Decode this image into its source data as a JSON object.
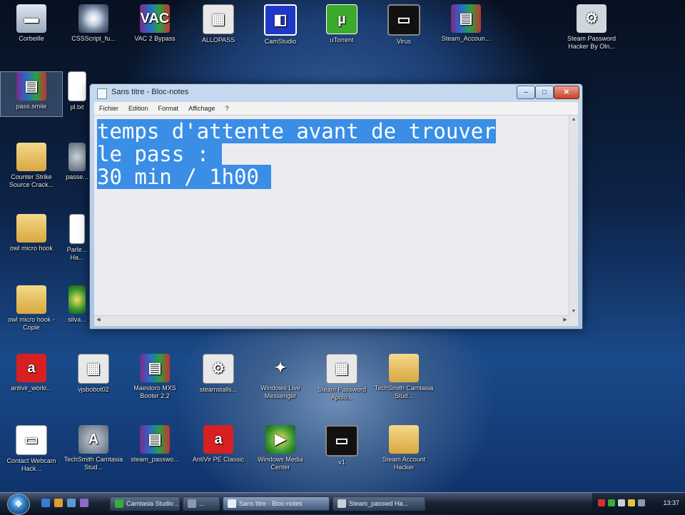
{
  "desktop": {
    "icons": [
      {
        "label": "Corbeille",
        "glyph": "▬"
      },
      {
        "label": "CSSScript_fu...",
        "glyph": ""
      },
      {
        "label": "VAC 2 Bypass",
        "glyph": "VAC"
      },
      {
        "label": "ALLOPASS",
        "glyph": "▦"
      },
      {
        "label": "CamStudio",
        "glyph": "◧"
      },
      {
        "label": "uTorrent",
        "glyph": "µ"
      },
      {
        "label": "Virus",
        "glyph": "▭"
      },
      {
        "label": "Steam_Accoun...",
        "glyph": "▤"
      },
      {
        "label": "Steam Password Hacker By Oln...",
        "glyph": "⚙"
      },
      {
        "label": "pass.smile",
        "glyph": "▤"
      },
      {
        "label": "pl.txt",
        "glyph": ""
      },
      {
        "label": "Counter Strike Source Crack...",
        "glyph": ""
      },
      {
        "label": "passe...",
        "glyph": ""
      },
      {
        "label": "owl micro hook",
        "glyph": ""
      },
      {
        "label": "Parle... Ha...",
        "glyph": ""
      },
      {
        "label": "owl micro hook - Copie",
        "glyph": ""
      },
      {
        "label": "silva...",
        "glyph": ""
      },
      {
        "label": "antivir_worki...",
        "glyph": "a"
      },
      {
        "label": "vjsbobot02",
        "glyph": "▦"
      },
      {
        "label": "Maestoro MXS Booter 2.2",
        "glyph": "▤"
      },
      {
        "label": "steamstalls...",
        "glyph": "⚙"
      },
      {
        "label": "Windows Live Messenger",
        "glyph": "✦"
      },
      {
        "label": "Steam Password Apolo...",
        "glyph": "▦"
      },
      {
        "label": "TechSmith Camtasia Stud...",
        "glyph": ""
      },
      {
        "label": "Contact Webcam Hack...",
        "glyph": "▭"
      },
      {
        "label": "TechSmith Camtasia Stud...",
        "glyph": "A"
      },
      {
        "label": "steam_passwo...",
        "glyph": "▤"
      },
      {
        "label": "AntiVir PE Classic",
        "glyph": "a"
      },
      {
        "label": "Windows Media Center",
        "glyph": "▶"
      },
      {
        "label": "v1",
        "glyph": "▭"
      },
      {
        "label": "Steam Account Hacker",
        "glyph": ""
      }
    ]
  },
  "notepad": {
    "title": "Sans titre - Bloc-notes",
    "controls": {
      "minimize": "–",
      "maximize": "□",
      "close": "✕"
    },
    "menu": [
      "Fichier",
      "Edition",
      "Format",
      "Affichage",
      "?"
    ],
    "lines": [
      "temps d'attente avant de trouver",
      "le pass : ",
      "30 min / 1h00 "
    ],
    "selection_color": "#3a8ee6"
  },
  "taskbar": {
    "start_glyph": "❖",
    "buttons": [
      {
        "label": "Camtasia Studio ..."
      },
      {
        "label": "..."
      },
      {
        "label": "Sans titre - Bloc-notes"
      },
      {
        "label": "Steam_passwd Ha..."
      }
    ],
    "clock": "13:37"
  }
}
